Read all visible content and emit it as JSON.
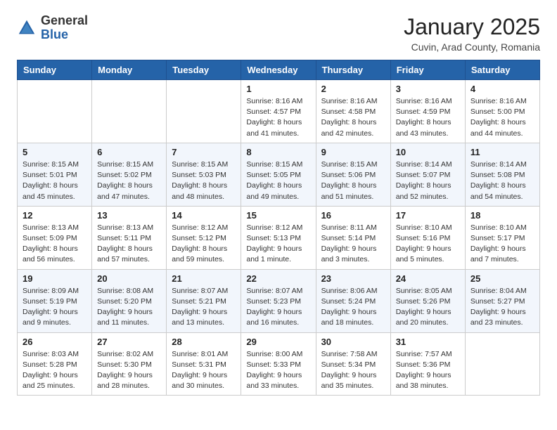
{
  "header": {
    "logo_general": "General",
    "logo_blue": "Blue",
    "month_title": "January 2025",
    "location": "Cuvin, Arad County, Romania"
  },
  "weekdays": [
    "Sunday",
    "Monday",
    "Tuesday",
    "Wednesday",
    "Thursday",
    "Friday",
    "Saturday"
  ],
  "weeks": [
    [
      {
        "day": "",
        "info": ""
      },
      {
        "day": "",
        "info": ""
      },
      {
        "day": "",
        "info": ""
      },
      {
        "day": "1",
        "info": "Sunrise: 8:16 AM\nSunset: 4:57 PM\nDaylight: 8 hours and 41 minutes."
      },
      {
        "day": "2",
        "info": "Sunrise: 8:16 AM\nSunset: 4:58 PM\nDaylight: 8 hours and 42 minutes."
      },
      {
        "day": "3",
        "info": "Sunrise: 8:16 AM\nSunset: 4:59 PM\nDaylight: 8 hours and 43 minutes."
      },
      {
        "day": "4",
        "info": "Sunrise: 8:16 AM\nSunset: 5:00 PM\nDaylight: 8 hours and 44 minutes."
      }
    ],
    [
      {
        "day": "5",
        "info": "Sunrise: 8:15 AM\nSunset: 5:01 PM\nDaylight: 8 hours and 45 minutes."
      },
      {
        "day": "6",
        "info": "Sunrise: 8:15 AM\nSunset: 5:02 PM\nDaylight: 8 hours and 47 minutes."
      },
      {
        "day": "7",
        "info": "Sunrise: 8:15 AM\nSunset: 5:03 PM\nDaylight: 8 hours and 48 minutes."
      },
      {
        "day": "8",
        "info": "Sunrise: 8:15 AM\nSunset: 5:05 PM\nDaylight: 8 hours and 49 minutes."
      },
      {
        "day": "9",
        "info": "Sunrise: 8:15 AM\nSunset: 5:06 PM\nDaylight: 8 hours and 51 minutes."
      },
      {
        "day": "10",
        "info": "Sunrise: 8:14 AM\nSunset: 5:07 PM\nDaylight: 8 hours and 52 minutes."
      },
      {
        "day": "11",
        "info": "Sunrise: 8:14 AM\nSunset: 5:08 PM\nDaylight: 8 hours and 54 minutes."
      }
    ],
    [
      {
        "day": "12",
        "info": "Sunrise: 8:13 AM\nSunset: 5:09 PM\nDaylight: 8 hours and 56 minutes."
      },
      {
        "day": "13",
        "info": "Sunrise: 8:13 AM\nSunset: 5:11 PM\nDaylight: 8 hours and 57 minutes."
      },
      {
        "day": "14",
        "info": "Sunrise: 8:12 AM\nSunset: 5:12 PM\nDaylight: 8 hours and 59 minutes."
      },
      {
        "day": "15",
        "info": "Sunrise: 8:12 AM\nSunset: 5:13 PM\nDaylight: 9 hours and 1 minute."
      },
      {
        "day": "16",
        "info": "Sunrise: 8:11 AM\nSunset: 5:14 PM\nDaylight: 9 hours and 3 minutes."
      },
      {
        "day": "17",
        "info": "Sunrise: 8:10 AM\nSunset: 5:16 PM\nDaylight: 9 hours and 5 minutes."
      },
      {
        "day": "18",
        "info": "Sunrise: 8:10 AM\nSunset: 5:17 PM\nDaylight: 9 hours and 7 minutes."
      }
    ],
    [
      {
        "day": "19",
        "info": "Sunrise: 8:09 AM\nSunset: 5:19 PM\nDaylight: 9 hours and 9 minutes."
      },
      {
        "day": "20",
        "info": "Sunrise: 8:08 AM\nSunset: 5:20 PM\nDaylight: 9 hours and 11 minutes."
      },
      {
        "day": "21",
        "info": "Sunrise: 8:07 AM\nSunset: 5:21 PM\nDaylight: 9 hours and 13 minutes."
      },
      {
        "day": "22",
        "info": "Sunrise: 8:07 AM\nSunset: 5:23 PM\nDaylight: 9 hours and 16 minutes."
      },
      {
        "day": "23",
        "info": "Sunrise: 8:06 AM\nSunset: 5:24 PM\nDaylight: 9 hours and 18 minutes."
      },
      {
        "day": "24",
        "info": "Sunrise: 8:05 AM\nSunset: 5:26 PM\nDaylight: 9 hours and 20 minutes."
      },
      {
        "day": "25",
        "info": "Sunrise: 8:04 AM\nSunset: 5:27 PM\nDaylight: 9 hours and 23 minutes."
      }
    ],
    [
      {
        "day": "26",
        "info": "Sunrise: 8:03 AM\nSunset: 5:28 PM\nDaylight: 9 hours and 25 minutes."
      },
      {
        "day": "27",
        "info": "Sunrise: 8:02 AM\nSunset: 5:30 PM\nDaylight: 9 hours and 28 minutes."
      },
      {
        "day": "28",
        "info": "Sunrise: 8:01 AM\nSunset: 5:31 PM\nDaylight: 9 hours and 30 minutes."
      },
      {
        "day": "29",
        "info": "Sunrise: 8:00 AM\nSunset: 5:33 PM\nDaylight: 9 hours and 33 minutes."
      },
      {
        "day": "30",
        "info": "Sunrise: 7:58 AM\nSunset: 5:34 PM\nDaylight: 9 hours and 35 minutes."
      },
      {
        "day": "31",
        "info": "Sunrise: 7:57 AM\nSunset: 5:36 PM\nDaylight: 9 hours and 38 minutes."
      },
      {
        "day": "",
        "info": ""
      }
    ]
  ]
}
